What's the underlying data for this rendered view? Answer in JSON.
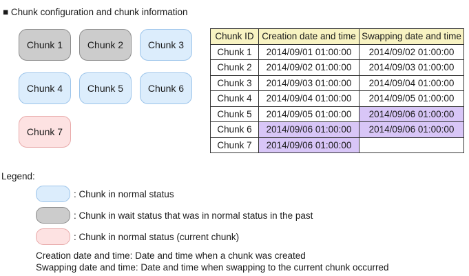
{
  "heading": "■ Chunk configuration and chunk information",
  "chunks": [
    {
      "label": "Chunk 1",
      "status": "wait"
    },
    {
      "label": "Chunk 2",
      "status": "wait"
    },
    {
      "label": "Chunk 3",
      "status": "normal"
    },
    {
      "label": "Chunk 4",
      "status": "normal"
    },
    {
      "label": "Chunk 5",
      "status": "normal"
    },
    {
      "label": "Chunk 6",
      "status": "normal"
    },
    {
      "label": "Chunk 7",
      "status": "current"
    }
  ],
  "table": {
    "headers": [
      "Chunk ID",
      "Creation date and time",
      "Swapping date and time"
    ],
    "rows": [
      [
        "Chunk 1",
        "2014/09/01 01:00:00",
        "2014/09/02 01:00:00"
      ],
      [
        "Chunk 2",
        "2014/09/02 01:00:00",
        "2014/09/03 01:00:00"
      ],
      [
        "Chunk 3",
        "2014/09/03 01:00:00",
        "2014/09/04 01:00:00"
      ],
      [
        "Chunk 4",
        "2014/09/04 01:00:00",
        "2014/09/05 01:00:00"
      ],
      [
        "Chunk 5",
        "2014/09/05 01:00:00",
        "2014/09/06 01:00:00"
      ],
      [
        "Chunk 6",
        "2014/09/06 01:00:00",
        "2014/09/06 01:00:00"
      ],
      [
        "Chunk 7",
        "2014/09/06 01:00:00",
        ""
      ]
    ],
    "highlighted_cells": [
      [
        4,
        2
      ],
      [
        5,
        1
      ],
      [
        5,
        2
      ],
      [
        6,
        1
      ]
    ]
  },
  "legend": {
    "title": "Legend:",
    "items": [
      {
        "status": "normal",
        "text": ": Chunk in normal status"
      },
      {
        "status": "wait",
        "text": ": Chunk in wait status that was in normal status in the past"
      },
      {
        "status": "current",
        "text": ": Chunk in normal status (current chunk)"
      }
    ],
    "notes": [
      "Creation date and time: Date and time when a chunk was created",
      "Swapping date and time: Date and time when swapping to the current chunk occurred"
    ]
  },
  "colors": {
    "wait": "#cccccc",
    "normal": "#dcedfc",
    "current": "#fde2e2",
    "table_header": "#f8f3c2",
    "table_highlight": "#d8c6f7"
  }
}
